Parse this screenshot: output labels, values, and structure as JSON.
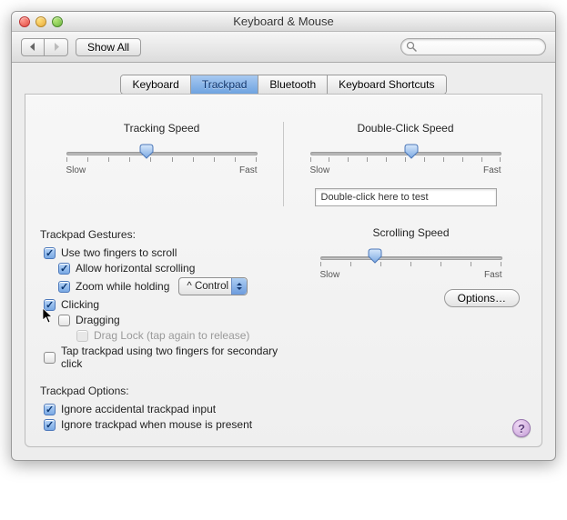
{
  "window": {
    "title": "Keyboard & Mouse"
  },
  "toolbar": {
    "show_all": "Show All"
  },
  "search": {
    "placeholder": ""
  },
  "tabs": [
    "Keyboard",
    "Trackpad",
    "Bluetooth",
    "Keyboard Shortcuts"
  ],
  "active_tab": 1,
  "sliders": {
    "tracking": {
      "title": "Tracking Speed",
      "min_label": "Slow",
      "max_label": "Fast",
      "value": 0.42,
      "ticks": 10
    },
    "double_click": {
      "title": "Double-Click Speed",
      "min_label": "Slow",
      "max_label": "Fast",
      "value": 0.53,
      "ticks": 11,
      "test_label": "Double-click here to test"
    },
    "scrolling": {
      "title": "Scrolling Speed",
      "min_label": "Slow",
      "max_label": "Fast",
      "value": 0.3,
      "ticks": 7
    }
  },
  "gestures": {
    "heading": "Trackpad Gestures:",
    "two_finger_scroll": {
      "label": "Use two fingers to scroll",
      "checked": true
    },
    "horizontal_scroll": {
      "label": "Allow horizontal scrolling",
      "checked": true
    },
    "zoom_hold": {
      "label": "Zoom while holding",
      "checked": true,
      "modifier": "^ Control",
      "options_label": "Options…"
    },
    "clicking": {
      "label": "Clicking",
      "checked": true
    },
    "dragging": {
      "label": "Dragging",
      "checked": false
    },
    "drag_lock": {
      "label": "Drag Lock (tap again to release)",
      "checked": false,
      "disabled": true
    },
    "secondary_tap": {
      "label": "Tap trackpad using two fingers for secondary click",
      "checked": false
    }
  },
  "options": {
    "heading": "Trackpad Options:",
    "ignore_accidental": {
      "label": "Ignore accidental trackpad input",
      "checked": true
    },
    "ignore_when_mouse": {
      "label": "Ignore trackpad when mouse is present",
      "checked": true
    }
  },
  "help": "?"
}
